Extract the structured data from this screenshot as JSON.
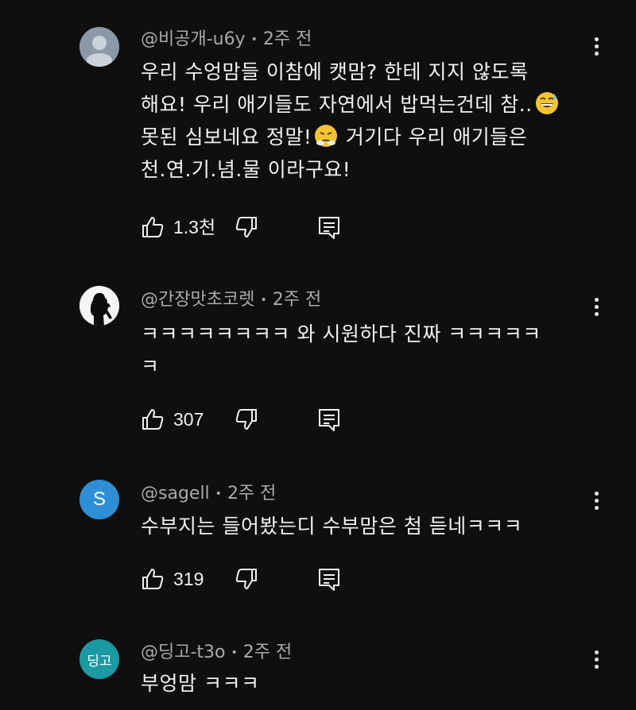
{
  "comments": [
    {
      "author": "@비공개-u6y",
      "time": "2주 전",
      "lines": [
        "우리 수엉맘들 이참에 캣맘? 한테 지지 않도록",
        "해요! 우리 애기들도 자연에서 밥먹는건데 참..",
        "못된 심보네요 정말!",
        "천.연.기.념.물 이라구요!"
      ],
      "line3_suffix": " 거기다 우리 애기들은",
      "likes": "1.3천",
      "avatar": "default-person"
    },
    {
      "author": "@간장맛초코렛",
      "time": "2주 전",
      "lines": [
        "ㅋㅋㅋㅋㅋㅋㅋㅋ  와 시원하다 진짜 ㅋㅋㅋㅋㅋ",
        "ㅋ"
      ],
      "likes": "307",
      "avatar": "silhouette"
    },
    {
      "author": "@sagell",
      "time": "2주 전",
      "lines": [
        "수부지는 들어봤는디 수부맘은 첨 듣네ㅋㅋㅋ"
      ],
      "likes": "319",
      "avatar_letter": "S",
      "avatar_color": "#2f8fd6"
    },
    {
      "author": "@딩고-t3o",
      "time": "2주 전",
      "lines": [
        "부엉맘 ㅋㅋㅋ"
      ],
      "avatar_letter": "딩고",
      "avatar_color": "#1b9aa3"
    }
  ],
  "separator": "•",
  "icons": {
    "like": "thumb-up-icon",
    "dislike": "thumb-down-icon",
    "reply": "reply-comment-icon",
    "menu": "more-vert-icon"
  }
}
